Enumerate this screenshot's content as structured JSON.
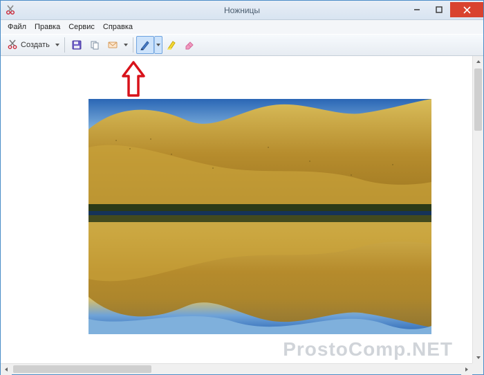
{
  "window": {
    "title": "Ножницы"
  },
  "menu": {
    "file": "Файл",
    "edit": "Правка",
    "tools": "Сервис",
    "help": "Справка"
  },
  "toolbar": {
    "new_label": "Создать"
  },
  "watermark": "ProstoComp.NET"
}
